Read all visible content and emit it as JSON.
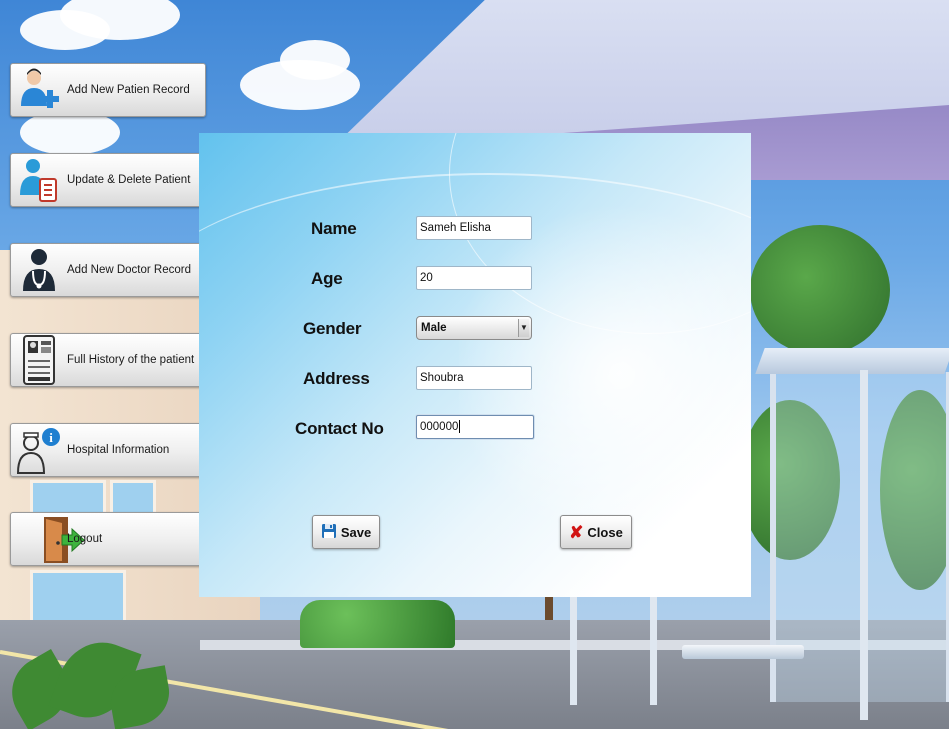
{
  "sidebar": {
    "items": [
      {
        "label": "Add New Patien Record",
        "icon": "add-patient-icon"
      },
      {
        "label": "Update & Delete Patient",
        "icon": "update-patient-icon"
      },
      {
        "label": "Add New Doctor Record",
        "icon": "doctor-icon"
      },
      {
        "label": "Full History of the patient",
        "icon": "patient-history-icon"
      },
      {
        "label": "Hospital Information",
        "icon": "hospital-info-icon"
      },
      {
        "label": "Logout",
        "icon": "logout-door-icon"
      }
    ]
  },
  "form": {
    "name_label": "Name",
    "name_value": "Sameh Elisha",
    "age_label": "Age",
    "age_value": "20",
    "gender_label": "Gender",
    "gender_value": "Male",
    "address_label": "Address",
    "address_value": "Shoubra",
    "contact_label": "Contact No",
    "contact_value": "000000"
  },
  "actions": {
    "save_label": "Save",
    "close_label": "Close"
  },
  "colors": {
    "accent": "#1f7fd0",
    "close_x": "#d11414",
    "door": "#c8783a",
    "arrow_green": "#3db33d"
  }
}
